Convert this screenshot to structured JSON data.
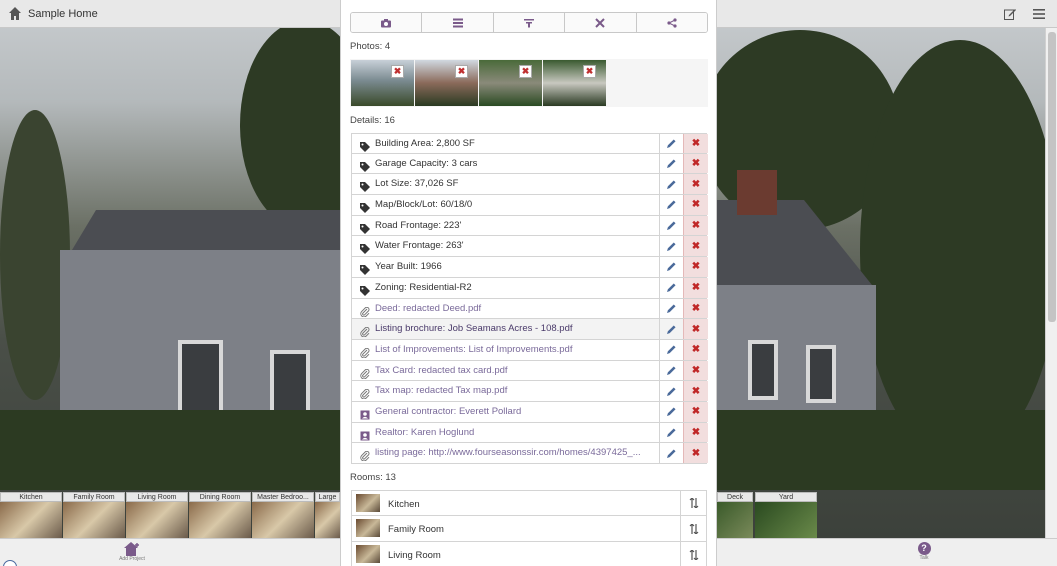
{
  "app": {
    "title": "Sample Home"
  },
  "toolbar": {
    "buttons": [
      "camera-icon",
      "list-icon",
      "filter-icon",
      "tools-icon",
      "share-icon"
    ]
  },
  "photos": {
    "label": "Photos: 4",
    "delete_glyph": "✖"
  },
  "details": {
    "label": "Details: 16",
    "items": [
      {
        "text": "Building Area: 2,800 SF",
        "icon": "tag-icon"
      },
      {
        "text": "Garage Capacity: 3 cars",
        "icon": "tag-icon"
      },
      {
        "text": "Lot Size: 37,026 SF",
        "icon": "tag-icon"
      },
      {
        "text": "Map/Block/Lot: 60/18/0",
        "icon": "tag-icon"
      },
      {
        "text": "Road Frontage: 223'",
        "icon": "tag-icon"
      },
      {
        "text": "Water Frontage: 263'",
        "icon": "tag-icon"
      },
      {
        "text": "Year Built: 1966",
        "icon": "tag-icon"
      },
      {
        "text": "Zoning: Residential-R2",
        "icon": "tag-icon"
      },
      {
        "text": "Deed: redacted Deed.pdf",
        "icon": "paperclip-icon"
      },
      {
        "text": "Listing brochure: Job Seamans Acres - 108.pdf",
        "icon": "paperclip-icon"
      },
      {
        "text": "List of Improvements: List of Improvements.pdf",
        "icon": "paperclip-icon"
      },
      {
        "text": "Tax Card: redacted tax card.pdf",
        "icon": "paperclip-icon"
      },
      {
        "text": "Tax map: redacted Tax map.pdf",
        "icon": "paperclip-icon"
      },
      {
        "text": "General contractor: Everett Pollard",
        "icon": "contact-icon"
      },
      {
        "text": "Realtor: Karen Hoglund",
        "icon": "contact-icon"
      },
      {
        "text": "listing page: http://www.fourseasonssir.com/homes/4397425_...",
        "icon": "paperclip-icon"
      }
    ],
    "delete_glyph": "✖"
  },
  "rooms": {
    "label": "Rooms: 13",
    "items": [
      "Kitchen",
      "Family Room",
      "Living Room"
    ]
  },
  "room_strip": {
    "left": [
      "Kitchen",
      "Family Room",
      "Living Room",
      "Dining Room",
      "Master Bedroo...",
      "Large"
    ],
    "right": [
      "Deck",
      "Yard"
    ]
  },
  "bottom": {
    "add_project": "Add Project",
    "talk": "Talk",
    "help_glyph": "?"
  },
  "colors": {
    "accent": "#7a5a8a",
    "link": "#7a6a9a",
    "delete_bg": "#f2dede",
    "delete_fg": "#c02828"
  }
}
